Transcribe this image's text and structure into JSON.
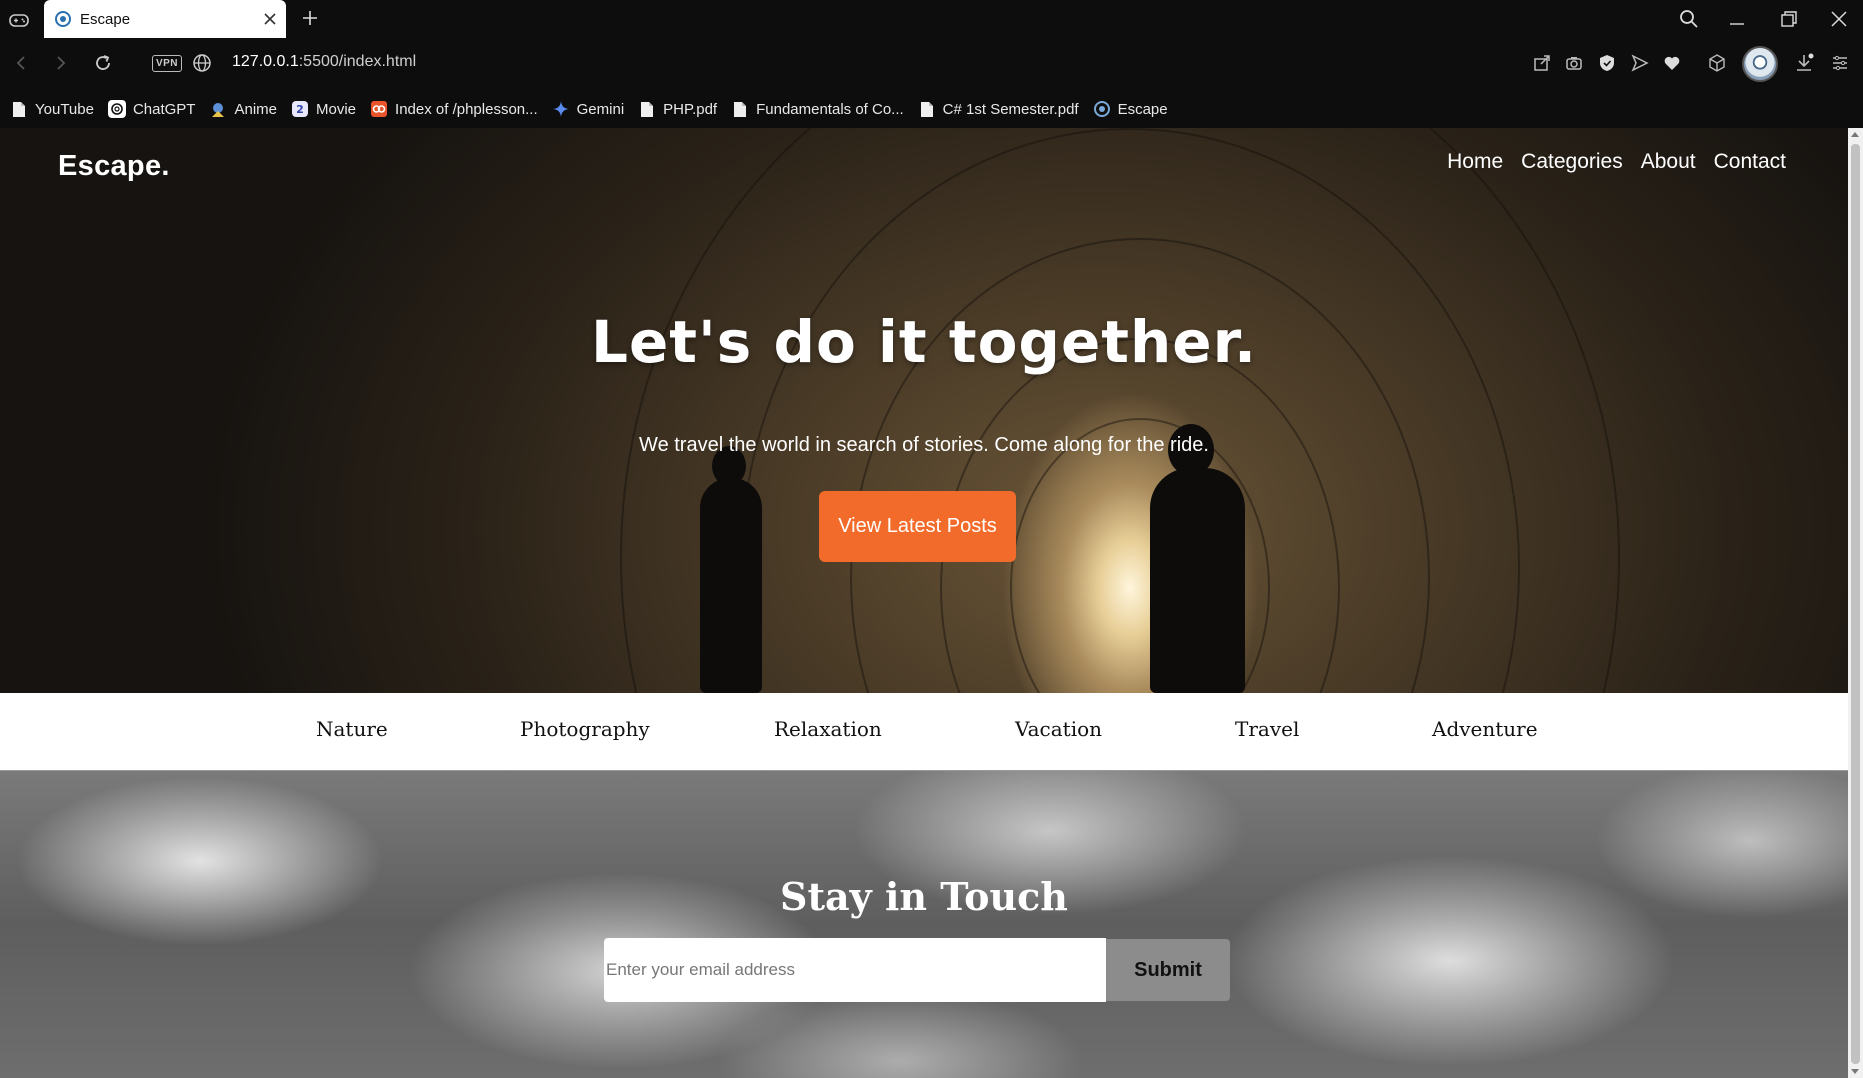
{
  "browser": {
    "tab_title": "Escape",
    "url_host": "127.0.0.1",
    "url_path": ":5500/index.html",
    "vpn_label": "VPN",
    "bookmarks": [
      {
        "label": "YouTube",
        "icon": "file-icon"
      },
      {
        "label": "ChatGPT",
        "icon": "chatgpt-icon"
      },
      {
        "label": "Anime",
        "icon": "anime-icon"
      },
      {
        "label": "Movie",
        "icon": "movie-icon"
      },
      {
        "label": "Index of /phplesson...",
        "icon": "site-icon"
      },
      {
        "label": "Gemini",
        "icon": "gemini-icon"
      },
      {
        "label": "PHP.pdf",
        "icon": "file-icon"
      },
      {
        "label": "Fundamentals of Co...",
        "icon": "file-icon"
      },
      {
        "label": "C# 1st Semester.pdf",
        "icon": "file-icon"
      },
      {
        "label": "Escape",
        "icon": "escape-favicon-icon"
      }
    ]
  },
  "page": {
    "logo": "Escape.",
    "nav": [
      "Home",
      "Categories",
      "About",
      "Contact"
    ],
    "hero_title": "Let's do it together.",
    "hero_subtitle": "We travel the world in search of stories. Come along for the ride.",
    "cta_label": "View Latest Posts",
    "categories": [
      "Nature",
      "Photography",
      "Relaxation",
      "Vacation",
      "Travel",
      "Adventure"
    ],
    "touch_title": "Stay in Touch",
    "email_placeholder": "Enter your email address",
    "submit_label": "Submit"
  },
  "colors": {
    "accent": "#f26b2a",
    "submit_bg": "#8c8c8c",
    "chrome_bg": "#0d0d0d"
  }
}
